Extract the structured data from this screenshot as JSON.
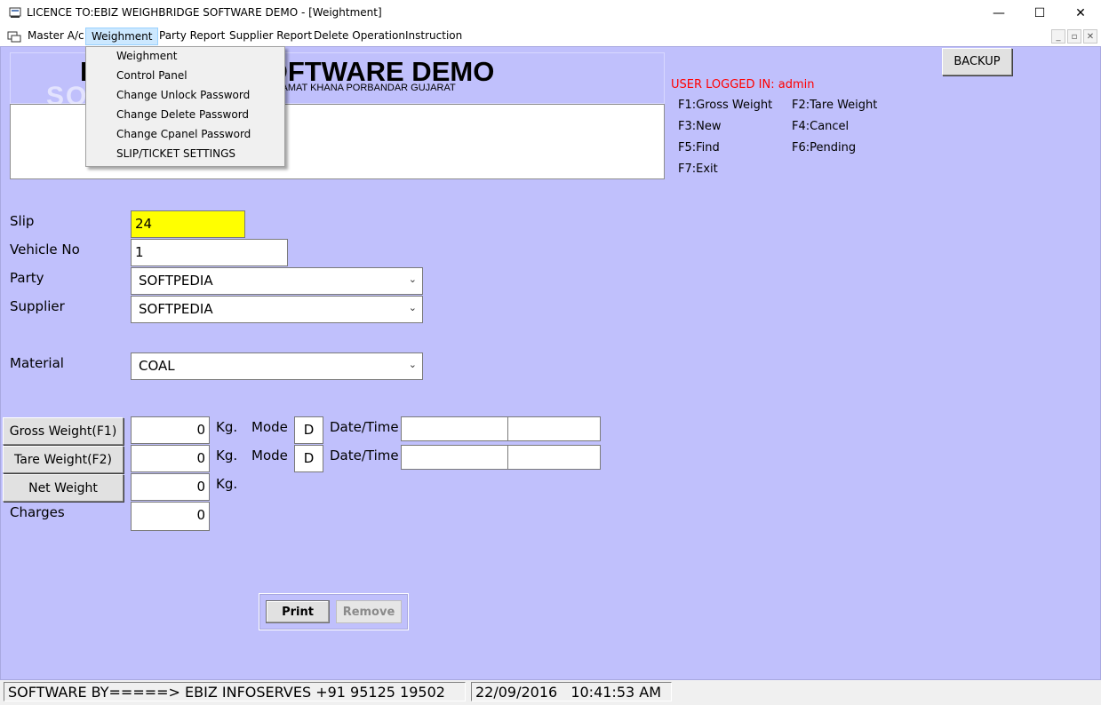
{
  "window": {
    "title": "LICENCE TO:EBIZ WEIGHBRIDGE SOFTWARE DEMO - [Weightment]",
    "minimize": "—",
    "maximize": "☐",
    "close": "✕"
  },
  "menu": {
    "items": [
      "Master A/c",
      "Weighment",
      "Party Report",
      "Supplier Report",
      "Delete Operation",
      "Instruction"
    ],
    "active": "Weighment",
    "mdi_controls": [
      "_",
      "▫",
      "✕"
    ]
  },
  "dropdown": {
    "items": [
      "Weighment",
      "Control Panel",
      "Change Unlock Password",
      "Change Delete Password",
      "Change Cpanel Password",
      "SLIP/TICKET SETTINGS"
    ]
  },
  "header": {
    "title": "EBIZ WEIGHBRIDGE SOFTWARE DEMO",
    "visible_title": "IDGE SOFTWARE DEMO",
    "title_lead": "I",
    "subtitle": "N JAMAT KHANA PORBANDAR GUJARAT",
    "watermark": "SOFTPEDIA"
  },
  "backup_label": "BACKUP",
  "user_logged": "USER LOGGED IN: admin",
  "shortcuts": [
    "F1:Gross Weight",
    "F2:Tare Weight",
    "F3:New",
    "F4:Cancel",
    "F5:Find",
    "F6:Pending",
    "F7:Exit"
  ],
  "form": {
    "slip_label": "Slip",
    "slip_value": "24",
    "vehicle_label": "Vehicle No",
    "vehicle_value": "1",
    "party_label": "Party",
    "party_value": "SOFTPEDIA",
    "supplier_label": "Supplier",
    "supplier_value": "SOFTPEDIA",
    "material_label": "Material",
    "material_value": "COAL"
  },
  "weights": {
    "gross_button": "Gross Weight(F1)",
    "tare_button": "Tare Weight(F2)",
    "net_button": "Net Weight",
    "charges_label": "Charges",
    "gross_value": "0",
    "tare_value": "0",
    "net_value": "0",
    "charges_value": "0",
    "unit": "Kg.",
    "mode_label": "Mode",
    "gross_mode": "D",
    "tare_mode": "D",
    "datetime_label": "Date/Time",
    "gross_date": "",
    "gross_time": "",
    "tare_date": "",
    "tare_time": ""
  },
  "actions": {
    "print": "Print",
    "remove": "Remove"
  },
  "status": {
    "credit": "SOFTWARE BY=====> EBIZ INFOSERVES +91 95125 19502",
    "date": "22/09/2016",
    "time": "10:41:53 AM"
  },
  "colors": {
    "client_bg": "#c0c0fc",
    "slip_bg": "#ffff00",
    "user_logged": "#ff0000"
  }
}
